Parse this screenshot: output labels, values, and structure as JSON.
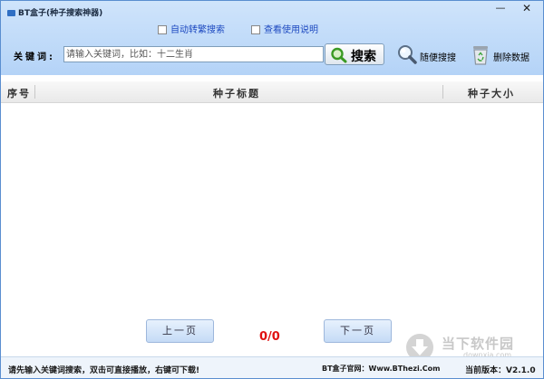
{
  "window": {
    "title": "BT盒子(种子搜索神器)",
    "minimize_glyph": "—",
    "close_glyph": "✕"
  },
  "options": {
    "auto_convert": "自动转繁搜索",
    "view_help": "查看使用说明"
  },
  "search": {
    "label": "关键词:",
    "placeholder": "请输入关键词，比如：十二生肖",
    "button_label": "搜索"
  },
  "toolbar": {
    "random_label": "随便搜搜",
    "delete_label": "删除数据"
  },
  "table": {
    "columns": [
      "序号",
      "种子标题",
      "种子大小"
    ]
  },
  "pager": {
    "prev_label": "上一页",
    "next_label": "下一页",
    "status": "0/0"
  },
  "status_bar": {
    "hint": "请先输入关键词搜索，双击可直接播放，右键可下载!",
    "site": "BT盒子官网：Www.BThezi.Com",
    "version": "当前版本：V2.1.0"
  },
  "watermark": {
    "brand": "当下软件园",
    "domain": "downxia.com"
  },
  "icons": {
    "search": "magnifier-icon",
    "random": "magnifier-icon",
    "delete": "recycle-bin-icon"
  },
  "colors": {
    "header_top": "#cfe4fb",
    "header_bottom": "#b4d3f7",
    "link_blue": "#1d49c0",
    "pager_red": "#e01010"
  }
}
